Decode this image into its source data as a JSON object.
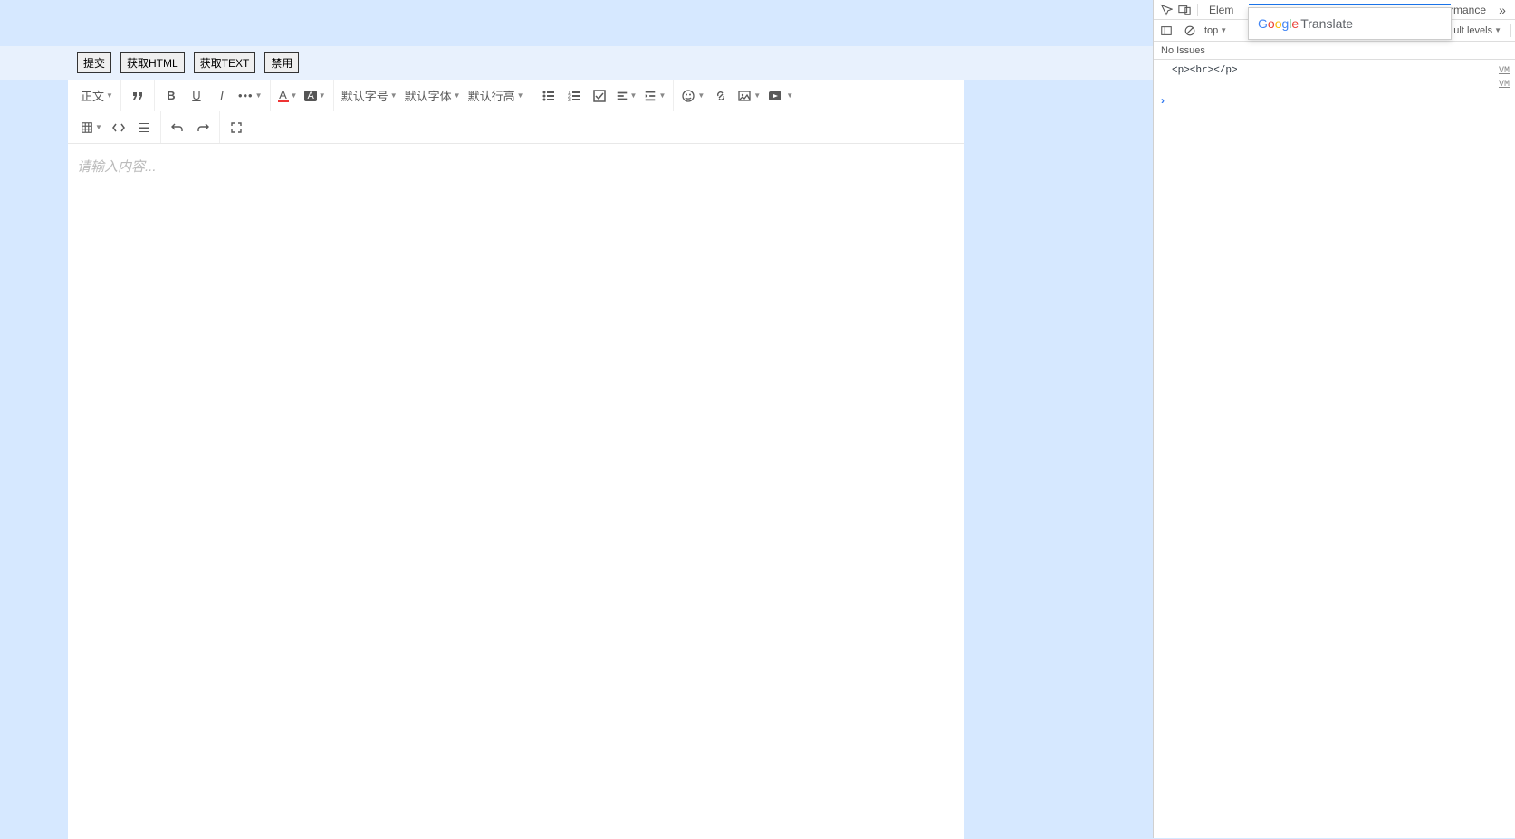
{
  "buttons": {
    "submit": "提交",
    "get_html": "获取HTML",
    "get_text": "获取TEXT",
    "disable": "禁用"
  },
  "toolbar": {
    "paragraph": "正文",
    "font_size": "默认字号",
    "font_family": "默认字体",
    "line_height": "默认行高"
  },
  "editor": {
    "placeholder": "请输入内容..."
  },
  "devtools": {
    "tab_elements": "Elem",
    "tab_performance": "rmance",
    "dropdown_top": "top",
    "default_levels": "ult levels",
    "no_issues": "No Issues",
    "console_line": "<p><br></p>",
    "vm": "VM"
  },
  "translate": {
    "google": "Google",
    "translate": "Translate"
  }
}
